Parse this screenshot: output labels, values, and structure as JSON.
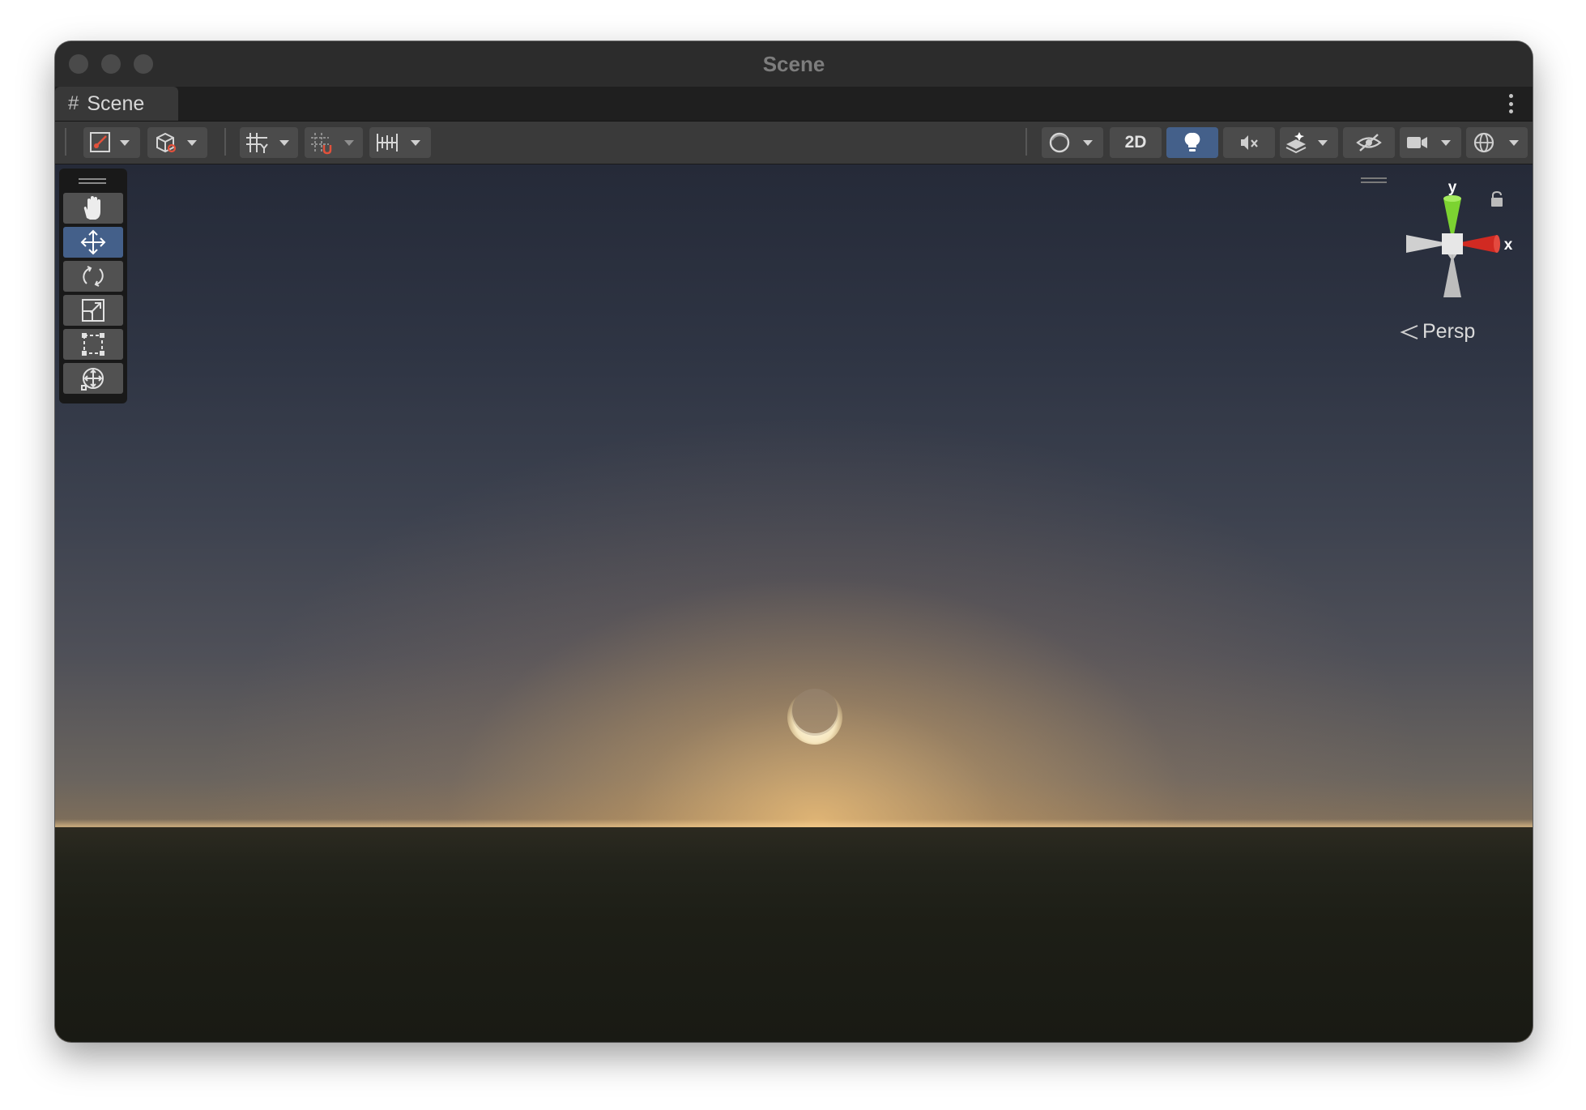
{
  "window": {
    "title": "Scene"
  },
  "tab": {
    "label": "Scene",
    "icon": "grid-hash-icon"
  },
  "toolbar": {
    "left": [
      {
        "icon": "view-tool-icon",
        "dropdown": true
      },
      {
        "icon": "pivot-cube-icon",
        "dropdown": true
      },
      {
        "icon": "grid-snap-icon",
        "dropdown": true
      },
      {
        "icon": "snap-increment-icon",
        "dropdown": true
      },
      {
        "icon": "ruler-icon",
        "dropdown": true
      }
    ],
    "right": {
      "shading_icon": "shading-sphere-icon",
      "mode_2d_label": "2D",
      "lighting_icon": "lightbulb-icon",
      "audio_icon": "audio-mute-icon",
      "effects_icon": "effects-layers-icon",
      "visibility_icon": "hidden-eye-icon",
      "camera_icon": "camera-icon",
      "gizmos_icon": "gizmos-globe-icon"
    }
  },
  "tools": [
    {
      "name": "hand-tool",
      "icon": "hand-icon",
      "selected": false
    },
    {
      "name": "move-tool",
      "icon": "move-arrows-icon",
      "selected": true
    },
    {
      "name": "rotate-tool",
      "icon": "rotate-icon",
      "selected": false
    },
    {
      "name": "scale-tool",
      "icon": "scale-icon",
      "selected": false
    },
    {
      "name": "rect-tool",
      "icon": "rect-transform-icon",
      "selected": false
    },
    {
      "name": "transform-tool",
      "icon": "transform-icon",
      "selected": false
    }
  ],
  "gizmo": {
    "y_label": "y",
    "x_label": "x",
    "projection_label": "Persp",
    "colors": {
      "x": "#d12a22",
      "y": "#7cd331",
      "neutral": "#c9c9c9"
    }
  },
  "colors": {
    "active_button": "#44608a",
    "toolbar_bg": "#3a3a3a"
  }
}
